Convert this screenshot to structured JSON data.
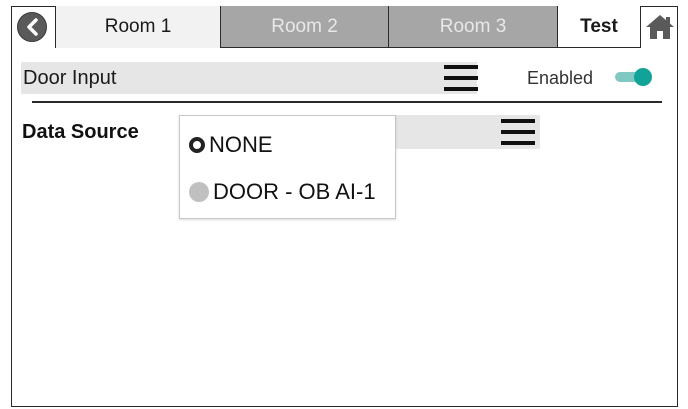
{
  "tabs": {
    "back_icon": "back-arrow-icon",
    "room1": "Room 1",
    "room2": "Room 2",
    "room3": "Room 3",
    "test": "Test",
    "home_icon": "home-icon"
  },
  "door_input": {
    "label": "Door Input",
    "menu_icon": "hamburger-icon",
    "enabled_label": "Enabled",
    "enabled": true
  },
  "data_source": {
    "label": "Data Source",
    "menu_icon": "hamburger-icon",
    "options": [
      {
        "label": "NONE",
        "selected": true
      },
      {
        "label": "DOOR - OB AI-1",
        "selected": false
      }
    ]
  },
  "colors": {
    "toggle_on": "#12a398",
    "tab_inactive": "#a6a6a6",
    "field_bg": "#e6e6e6"
  }
}
